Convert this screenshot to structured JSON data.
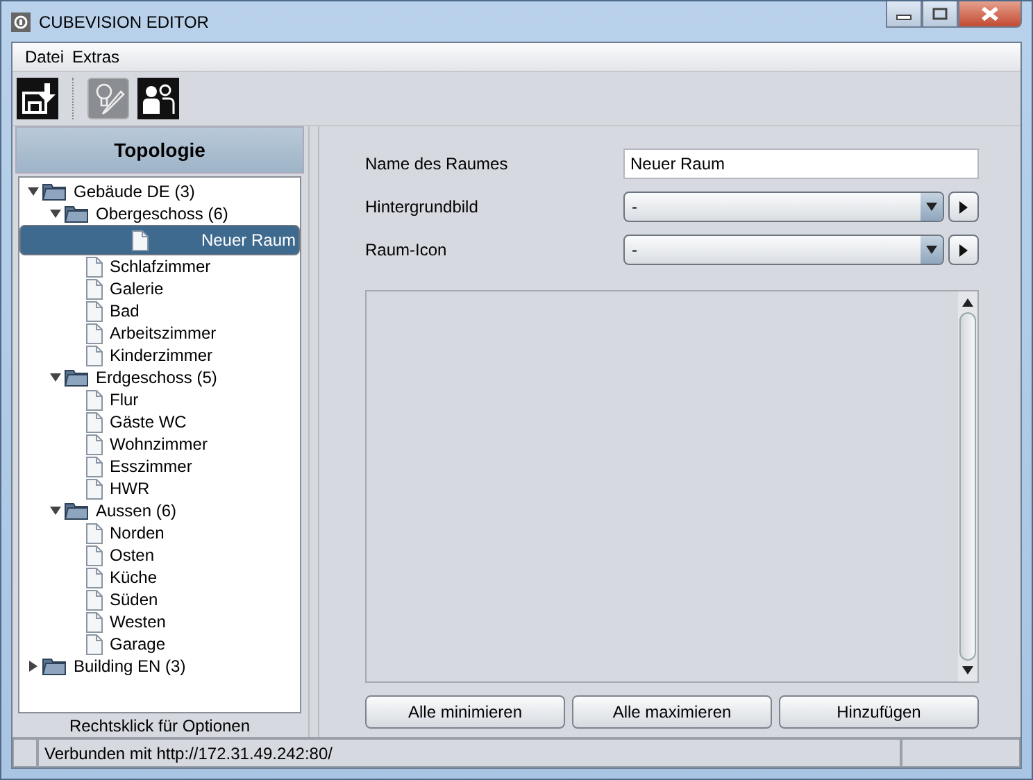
{
  "window": {
    "title": "CUBEVISION EDITOR"
  },
  "menu": [
    "Datei",
    "Extras"
  ],
  "toolbar": [
    {
      "kind": "save",
      "pressed": false
    },
    {
      "kind": "edit",
      "pressed": true
    },
    {
      "kind": "users",
      "pressed": false
    }
  ],
  "sidebar": {
    "title": "Topologie",
    "hint": "Rechtsklick für Optionen",
    "tree": [
      {
        "label": "Gebäude DE (3)",
        "kind": "folder",
        "expanded": true,
        "selected": false,
        "children": [
          {
            "label": "Obergeschoss (6)",
            "kind": "folder",
            "expanded": true,
            "selected": false,
            "children": [
              {
                "label": "Neuer Raum",
                "kind": "file",
                "selected": true
              },
              {
                "label": "Schlafzimmer",
                "kind": "file",
                "selected": false
              },
              {
                "label": "Galerie",
                "kind": "file",
                "selected": false
              },
              {
                "label": "Bad",
                "kind": "file",
                "selected": false
              },
              {
                "label": "Arbeitszimmer",
                "kind": "file",
                "selected": false
              },
              {
                "label": "Kinderzimmer",
                "kind": "file",
                "selected": false
              }
            ]
          },
          {
            "label": "Erdgeschoss (5)",
            "kind": "folder",
            "expanded": true,
            "selected": false,
            "children": [
              {
                "label": "Flur",
                "kind": "file",
                "selected": false
              },
              {
                "label": "Gäste WC",
                "kind": "file",
                "selected": false
              },
              {
                "label": "Wohnzimmer",
                "kind": "file",
                "selected": false
              },
              {
                "label": "Esszimmer",
                "kind": "file",
                "selected": false
              },
              {
                "label": "HWR",
                "kind": "file",
                "selected": false
              }
            ]
          },
          {
            "label": "Aussen (6)",
            "kind": "folder",
            "expanded": true,
            "selected": false,
            "children": [
              {
                "label": "Norden",
                "kind": "file",
                "selected": false
              },
              {
                "label": "Osten",
                "kind": "file",
                "selected": false
              },
              {
                "label": "Küche",
                "kind": "file",
                "selected": false
              },
              {
                "label": "Süden",
                "kind": "file",
                "selected": false
              },
              {
                "label": "Westen",
                "kind": "file",
                "selected": false
              },
              {
                "label": "Garage",
                "kind": "file",
                "selected": false
              }
            ]
          }
        ]
      },
      {
        "label": "Building EN (3)",
        "kind": "folder",
        "expanded": false,
        "selected": false
      }
    ]
  },
  "form": [
    {
      "label": "Name des Raumes",
      "kind": "text",
      "value": "Neuer Raum"
    },
    {
      "label": "Hintergrundbild",
      "kind": "select",
      "value": "-"
    },
    {
      "label": "Raum-Icon",
      "kind": "select",
      "value": "-"
    }
  ],
  "buttons": [
    "Alle minimieren",
    "Alle maximieren",
    "Hinzufügen"
  ],
  "status_bar": "Verbunden mit http://172.31.49.242:80/"
}
